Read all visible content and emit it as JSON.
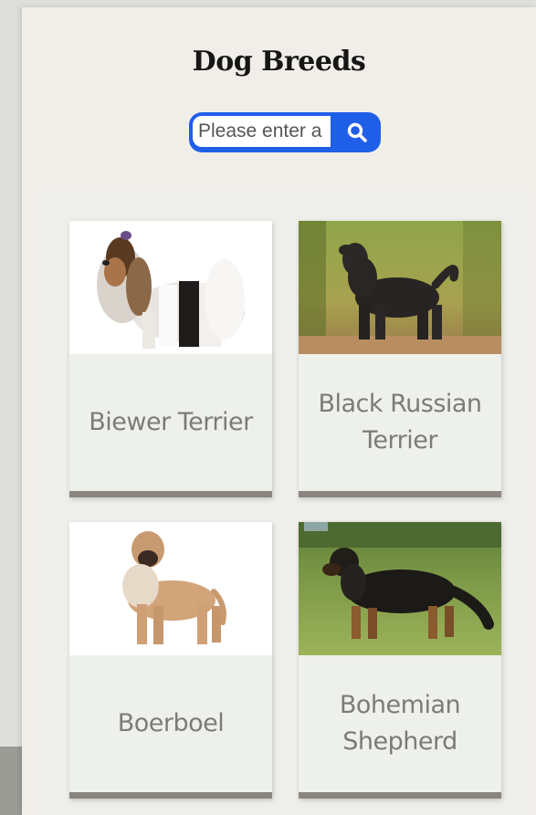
{
  "page": {
    "title": "Dog Breeds"
  },
  "search": {
    "placeholder": "Please enter a",
    "button_icon": "search-icon"
  },
  "colors": {
    "accent": "#1f5fe8",
    "panel": "#f1eee9",
    "card_bar": "#8a857f",
    "card_text": "#7d7b76"
  },
  "breeds": [
    {
      "name": "Biewer Terrier",
      "image": "dog-photo-biewer-terrier"
    },
    {
      "name": "Black Russian Terrier",
      "image": "dog-photo-black-russian-terrier"
    },
    {
      "name": "Boerboel",
      "image": "dog-photo-boerboel"
    },
    {
      "name": "Bohemian Shepherd",
      "image": "dog-photo-bohemian-shepherd"
    }
  ]
}
